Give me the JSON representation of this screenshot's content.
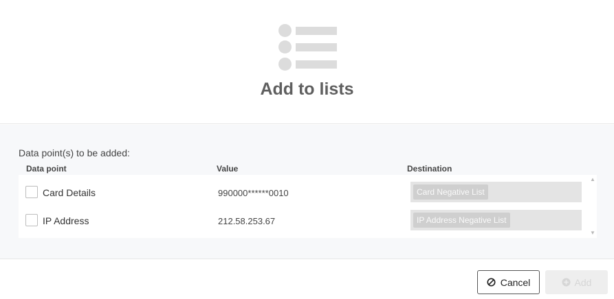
{
  "dialog": {
    "title": "Add to lists",
    "illustration_icon": "list-icon"
  },
  "section": {
    "subtitle": "Data point(s) to be added:",
    "columns": {
      "data_point": "Data point",
      "value": "Value",
      "destination": "Destination"
    },
    "rows": [
      {
        "label": "Card Details",
        "value": "990000******0010",
        "destination": "Card Negative List",
        "checked": false
      },
      {
        "label": "IP Address",
        "value": "212.58.253.67",
        "destination": "IP Address Negative List",
        "checked": false
      }
    ]
  },
  "footer": {
    "cancel_label": "Cancel",
    "cancel_icon": "ban-icon",
    "add_label": "Add",
    "add_icon": "plus-circle-icon"
  },
  "colors": {
    "illustration": "#dcdcdc",
    "title": "#5f5f5f",
    "section_bg": "#f7f8fa",
    "disabled_button_bg": "#eeeeee"
  }
}
